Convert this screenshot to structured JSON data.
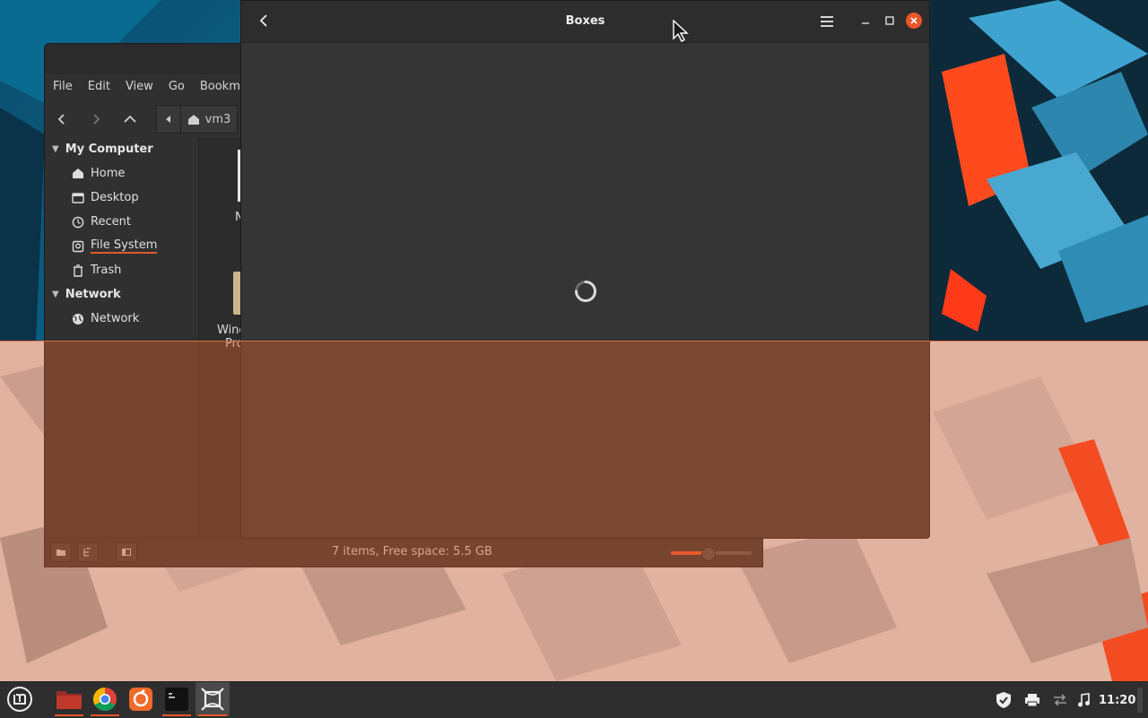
{
  "nemo": {
    "menu": [
      "File",
      "Edit",
      "View",
      "Go",
      "Bookmar"
    ],
    "path_label": "vm3",
    "sidebar": {
      "my_computer": "My Computer",
      "items": [
        "Home",
        "Desktop",
        "Recent",
        "File System",
        "Trash"
      ],
      "network_header": "Network",
      "network_items": [
        "Network"
      ]
    },
    "files": [
      {
        "label": "Ne"
      },
      {
        "label": "Wind",
        "label2": "Pro"
      }
    ],
    "status": "7 items, Free space: 5.5 GB",
    "zoom_level": 0.45
  },
  "boxes": {
    "title": "Boxes"
  },
  "taskbar": {
    "clock": "11:20",
    "apps": [
      "menu-icon",
      "files-icon",
      "chrome-icon",
      "firefox-icon",
      "terminal-icon",
      "boxes-icon"
    ]
  },
  "colors": {
    "accent": "#e9552a",
    "selection": "#e46432"
  }
}
